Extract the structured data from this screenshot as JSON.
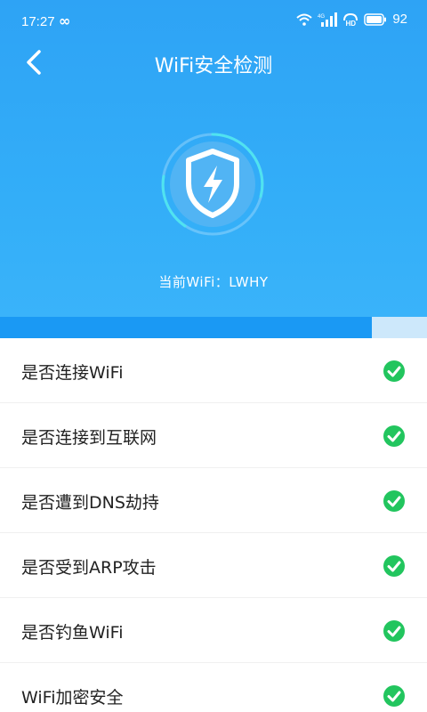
{
  "status_bar": {
    "time": "17:27",
    "loop_glyph": "∞",
    "battery": "92",
    "icons": [
      "wifi-icon",
      "signal-4g-icon",
      "hd-call-icon",
      "battery-icon"
    ]
  },
  "nav": {
    "back_icon": "chevron-left-icon",
    "title": "WiFi安全检测"
  },
  "scan": {
    "icon": "shield-lightning-icon",
    "current_wifi_label": "当前WiFi：LWHY",
    "progress": 0.87
  },
  "checks": [
    {
      "label": "是否连接WiFi",
      "status": "ok"
    },
    {
      "label": "是否连接到互联网",
      "status": "ok"
    },
    {
      "label": "是否遭到DNS劫持",
      "status": "ok"
    },
    {
      "label": "是否受到ARP攻击",
      "status": "ok"
    },
    {
      "label": "是否钓鱼WiFi",
      "status": "ok"
    },
    {
      "label": "WiFi加密安全",
      "status": "ok"
    }
  ],
  "colors": {
    "header": "#33aef8",
    "progress_fill": "#1a99f4",
    "progress_track": "#cde8fb",
    "check_green": "#22c55e"
  }
}
